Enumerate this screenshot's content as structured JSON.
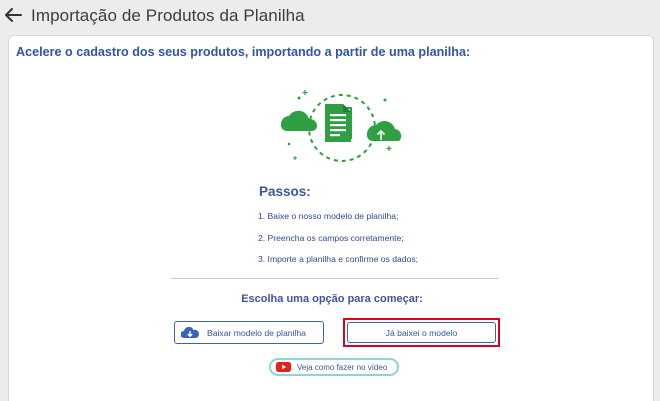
{
  "header": {
    "back_icon": "arrow-left-icon",
    "title": "Importação de Produtos da Planilha"
  },
  "main": {
    "intro": "Acelere o cadastro dos seus produtos, importando a partir de uma planilha:",
    "illustration_icon": "spreadsheet-cloud-upload-icon",
    "steps_title": "Passos:",
    "steps": [
      "1. Baixe o nosso modelo de planilha;",
      "2. Preencha os campos corretamente;",
      "3. Importe a planilha e confirme os dados;"
    ],
    "choose_prompt": "Escolha uma opção para começar:",
    "download_button": {
      "label": "Baixar modelo de planilha",
      "icon": "cloud-download-icon"
    },
    "done_button": {
      "label": "Já baixei o modelo",
      "highlight_color": "#e0001b"
    },
    "video_button": {
      "label": "Veja como fazer no vídeo",
      "icon": "youtube-icon"
    }
  },
  "colors": {
    "accent": "#2f56a7",
    "illustration_green": "#2ea043",
    "highlight": "#e0001b"
  }
}
